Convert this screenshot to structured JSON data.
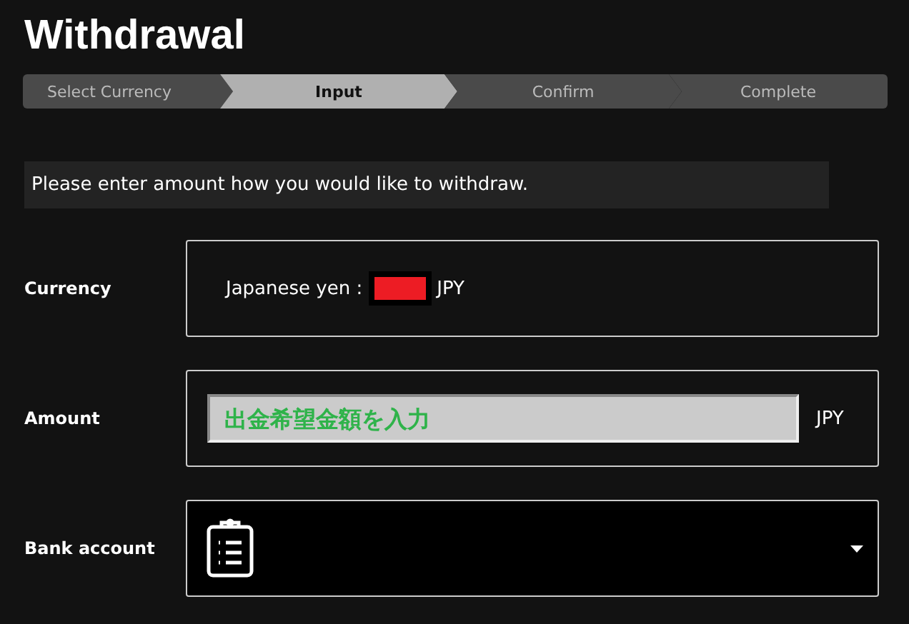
{
  "title": "Withdrawal",
  "steps": [
    {
      "label": "Select Currency",
      "selected": false
    },
    {
      "label": "Input",
      "selected": true
    },
    {
      "label": "Confirm",
      "selected": false
    },
    {
      "label": "Complete",
      "selected": false
    }
  ],
  "message": "Please enter amount how you would like to withdraw.",
  "fields": [
    {
      "kind": "text",
      "label": "Currency",
      "value": "Japanese yen :",
      "redacted": true,
      "unit": "JPY"
    },
    {
      "kind": "input",
      "label": "Amount",
      "placeholder": "出金希望金額を入力",
      "unit": "JPY"
    },
    {
      "kind": "select",
      "label": "Bank account"
    }
  ]
}
